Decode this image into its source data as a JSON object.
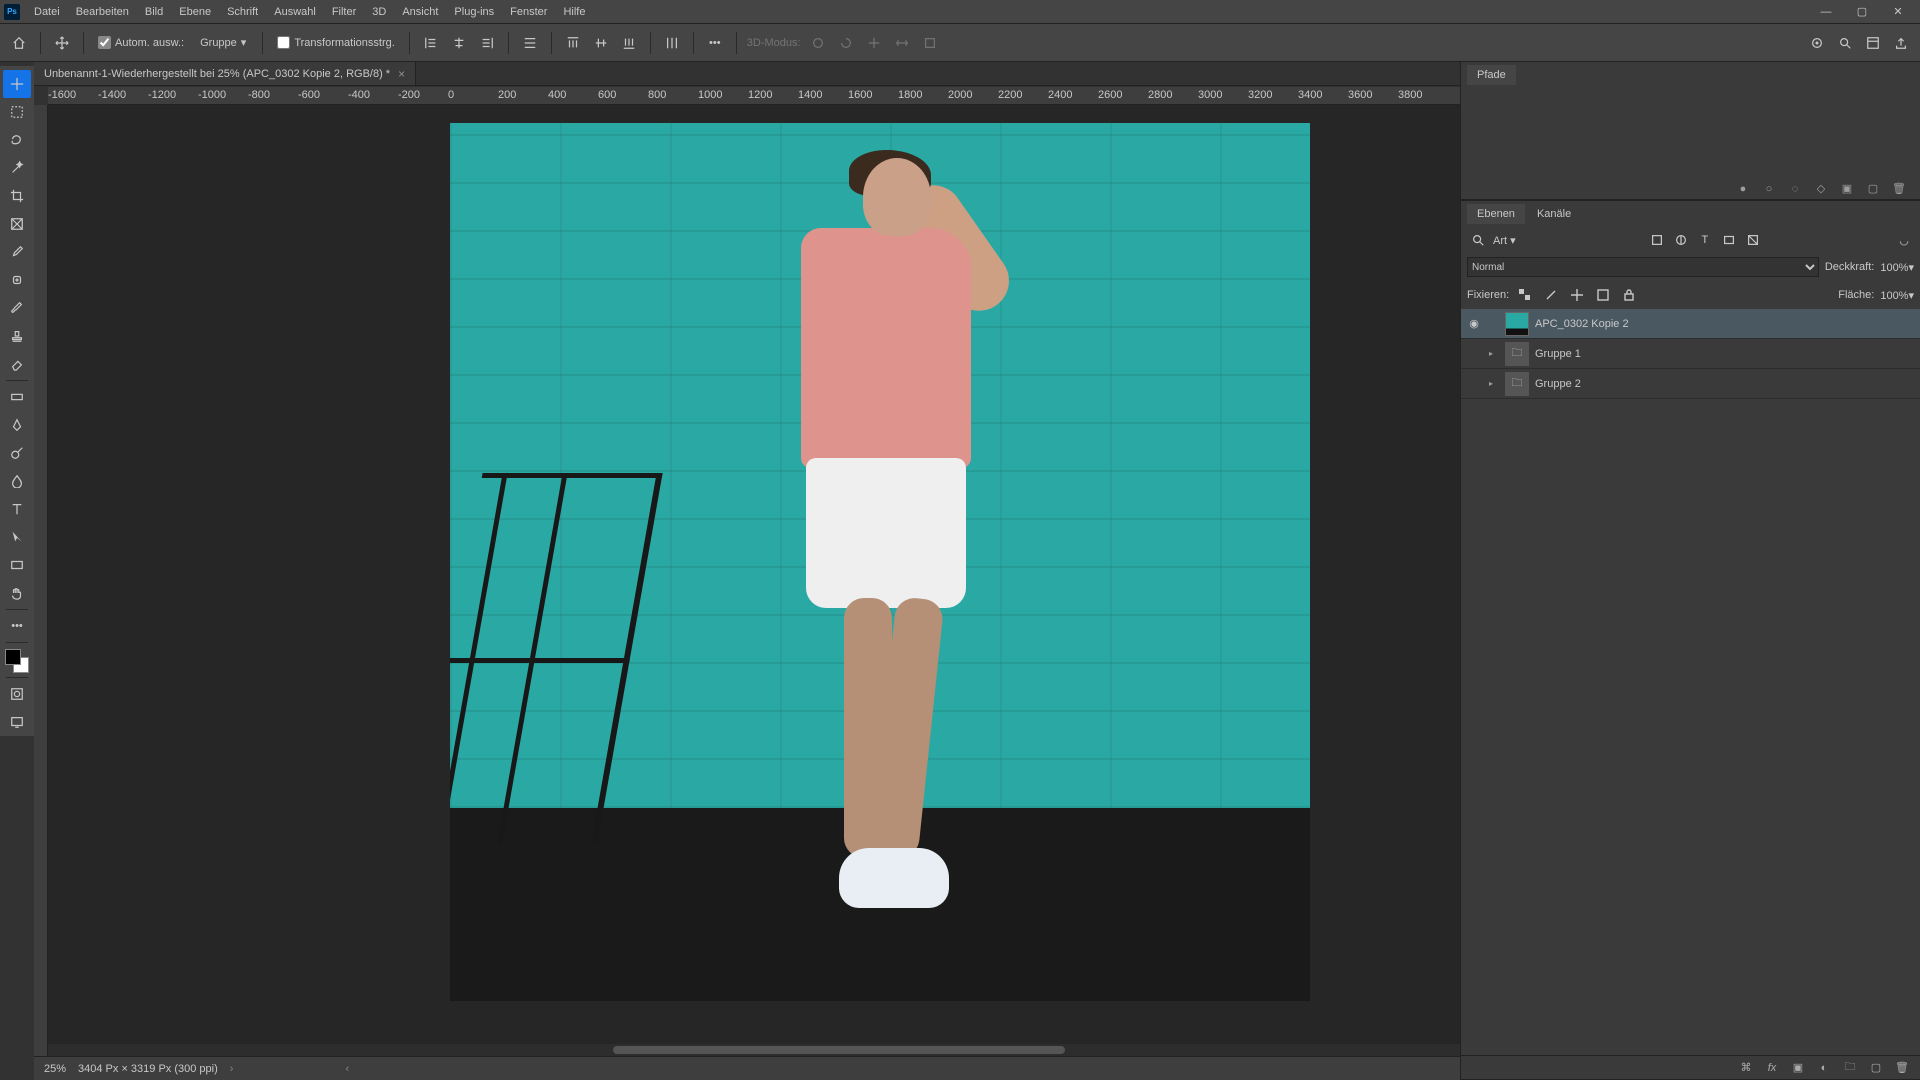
{
  "menubar": [
    "Datei",
    "Bearbeiten",
    "Bild",
    "Ebene",
    "Schrift",
    "Auswahl",
    "Filter",
    "3D",
    "Ansicht",
    "Plug-ins",
    "Fenster",
    "Hilfe"
  ],
  "optbar": {
    "auto_select": "Autom. ausw.:",
    "auto_select_target": "Gruppe",
    "transform": "Transformationsstrg.",
    "mode3d": "3D-Modus:"
  },
  "doc_tab": {
    "name": "Unbenannt-1-Wiederhergestellt bei 25% (APC_0302 Kopie 2, RGB/8) *"
  },
  "ruler_ticks": [
    "-1600",
    "-1400",
    "-1200",
    "-1000",
    "-800",
    "-600",
    "-400",
    "-200",
    "0",
    "200",
    "400",
    "600",
    "800",
    "1000",
    "1200",
    "1400",
    "1600",
    "1800",
    "2000",
    "2200",
    "2400",
    "2600",
    "2800",
    "3000",
    "3200",
    "3400",
    "3600",
    "3800"
  ],
  "pfade_tab": "Pfade",
  "layers": {
    "tabs": [
      "Ebenen",
      "Kanäle"
    ],
    "filter_kind": "Art",
    "blend": "Normal",
    "opacity_label": "Deckkraft:",
    "opacity_value": "100%",
    "lock_label": "Fixieren:",
    "fill_label": "Fläche:",
    "fill_value": "100%",
    "rows": [
      {
        "visible": true,
        "kind": "layer",
        "name": "APC_0302 Kopie 2",
        "selected": true
      },
      {
        "visible": false,
        "kind": "group",
        "name": "Gruppe 1",
        "selected": false
      },
      {
        "visible": false,
        "kind": "group",
        "name": "Gruppe 2",
        "selected": false
      }
    ]
  },
  "status": {
    "zoom": "25%",
    "doc": "3404 Px × 3319 Px (300 ppi)"
  }
}
